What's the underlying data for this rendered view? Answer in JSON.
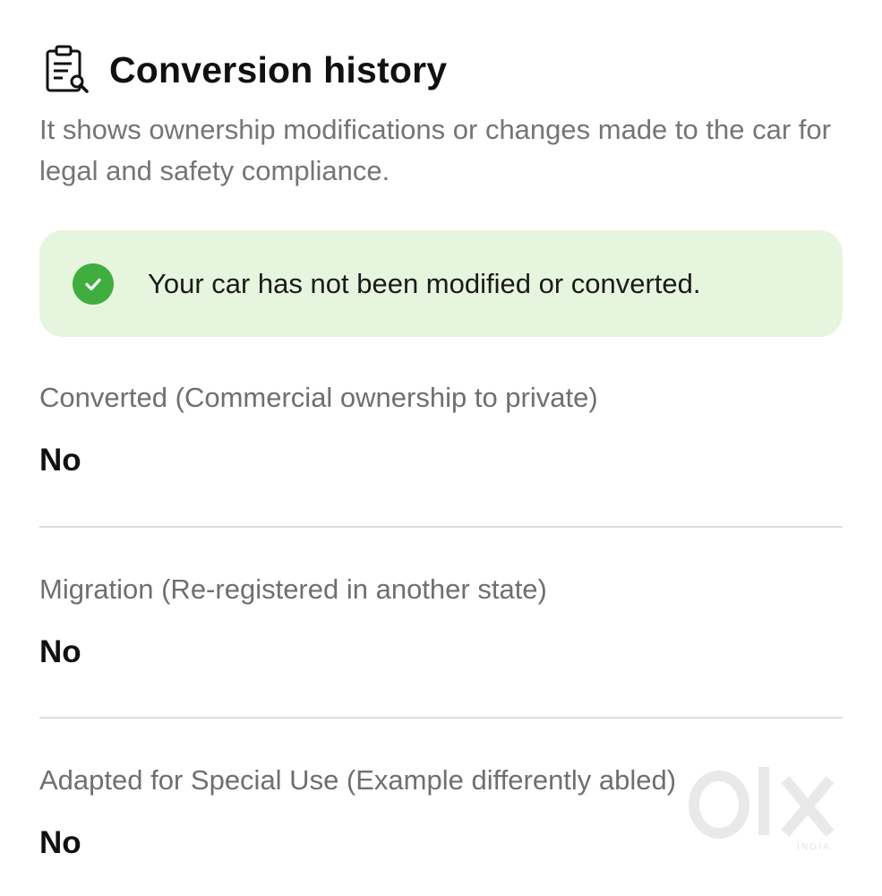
{
  "header": {
    "title": "Conversion history",
    "icon": "clipboard-wrench-icon"
  },
  "subtitle": "It shows ownership modifications or changes made to the car for legal and safety compliance.",
  "status": {
    "icon": "check-circle-icon",
    "text": "Your car has not been modified or converted.",
    "background": "#e6f5de",
    "check_color": "#3fae3f"
  },
  "fields": [
    {
      "label": "Converted (Commercial ownership to private)",
      "value": "No"
    },
    {
      "label": "Migration (Re-registered in another state)",
      "value": "No"
    },
    {
      "label": "Adapted for Special Use (Example differently abled)",
      "value": "No"
    }
  ],
  "watermark": {
    "brand": "olx",
    "region": "INDIA"
  }
}
